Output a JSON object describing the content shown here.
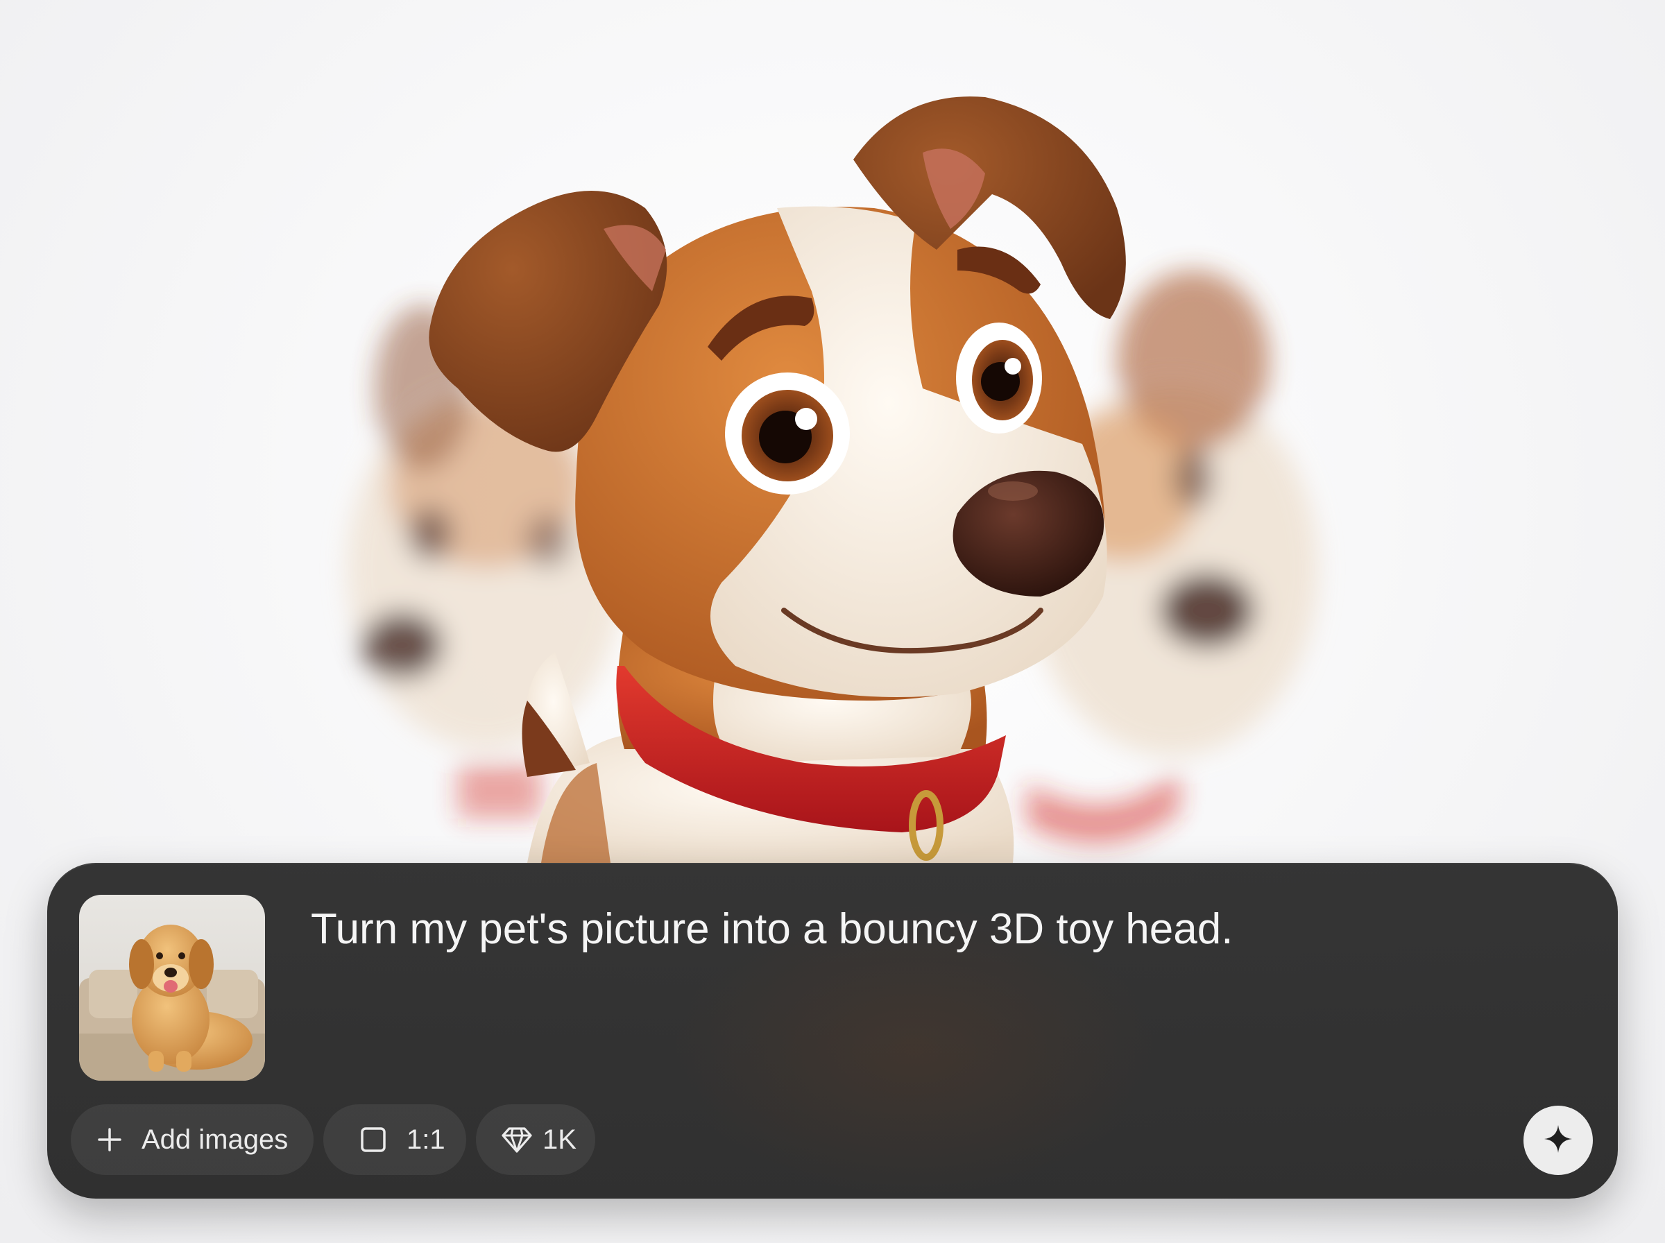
{
  "composer": {
    "prompt_text": "Turn my pet's picture into a bouncy 3D toy head.",
    "toolbar": {
      "add_images_label": "Add images",
      "add_icon": "plus-icon",
      "aspect_ratio_label": "1:1",
      "aspect_icon": "square-icon",
      "resolution_label": "1K",
      "resolution_icon": "diamond-icon",
      "generate_icon": "sparkle-icon"
    }
  },
  "colors": {
    "panel": "#2a2a2a",
    "panel_text": "#f5f5f5",
    "pill_bg": "#3a3a3a",
    "generate_button": "#ededed",
    "collar": "#c8201e",
    "fur_brown": "#b8652a",
    "fur_cream": "#f3e6d6"
  }
}
